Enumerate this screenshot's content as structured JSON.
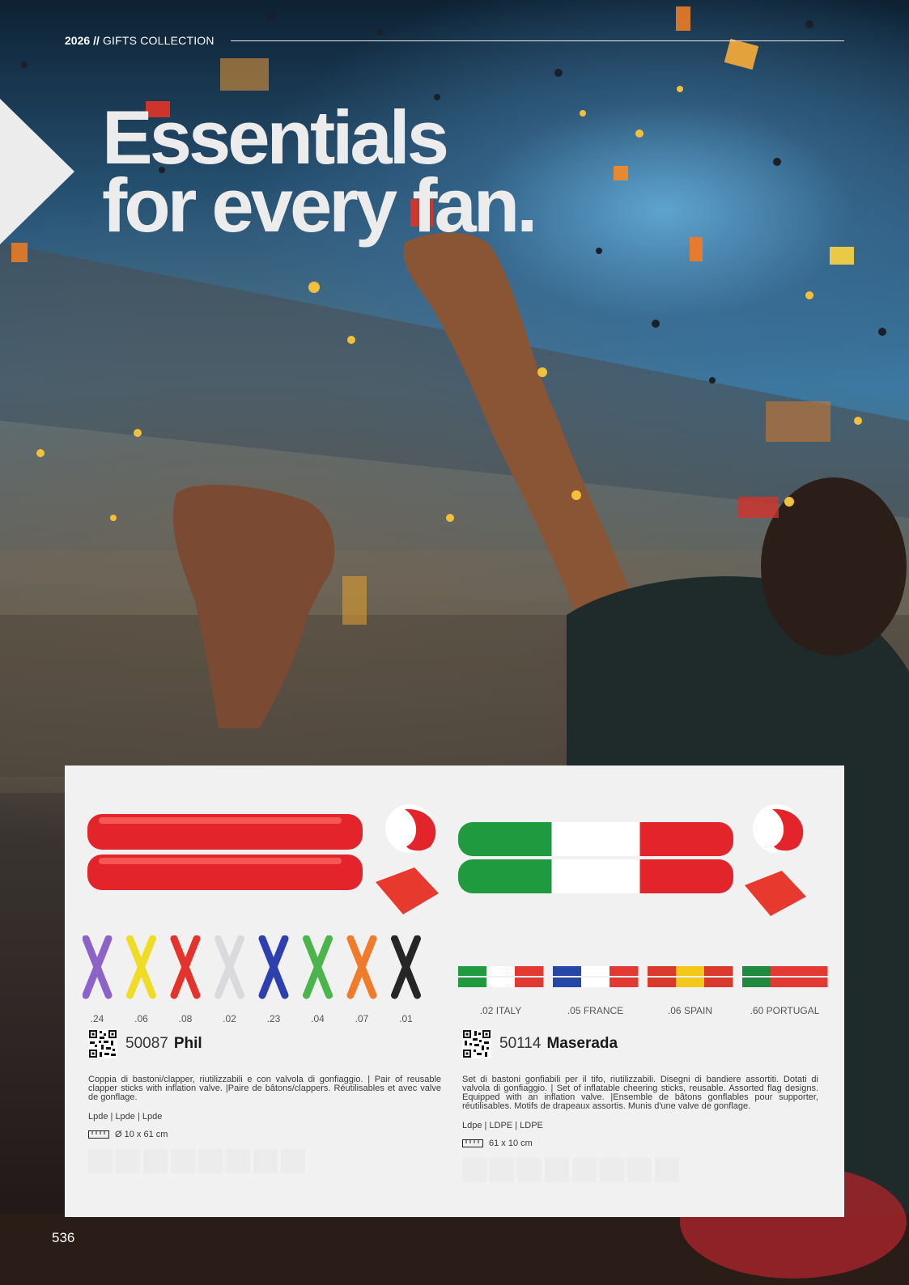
{
  "header": {
    "year": "2026",
    "separator": "//",
    "collection": "GIFTS COLLECTION"
  },
  "title": {
    "line1": "Essentials",
    "line2": "for every fan."
  },
  "products": [
    {
      "code": "50087",
      "name": "Phil",
      "description": "Coppia di bastoni/clapper, riutilizzabili e con valvola di gonfiaggio. | Pair of reusable clapper sticks with inflation valve. |Paire de bâtons/clappers. Réutilisables et avec valve de gonflage.",
      "material": "Lpde | Lpde | Lpde",
      "dimensions": "Ø 10 x 61 cm",
      "colors": [
        {
          "code": ".24",
          "hex": "#8d63c8"
        },
        {
          "code": ".06",
          "hex": "#f0dc24"
        },
        {
          "code": ".08",
          "hex": "#e3332c"
        },
        {
          "code": ".02",
          "hex": "#e0e0e2"
        },
        {
          "code": ".23",
          "hex": "#2e3fb0"
        },
        {
          "code": ".04",
          "hex": "#4bb54c"
        },
        {
          "code": ".07",
          "hex": "#f07b2a"
        },
        {
          "code": ".01",
          "hex": "#262626"
        }
      ]
    },
    {
      "code": "50114",
      "name": "Maserada",
      "description": "Set di bastoni gonfiabili per il tifo, riutilizzabili. Disegni di bandiere assortiti. Dotati di valvola di gonfiaggio. | Set of inflatable cheering sticks, reusable. Assorted flag designs. Equipped with an inflation valve. |Ensemble de bâtons gonflables pour supporter, réutilisables. Motifs de drapeaux assortis. Munis d'une valve de gonflage.",
      "material": "Ldpe | LDPE | LDPE",
      "dimensions": "61 x 10 cm",
      "flags": [
        {
          "label": ".02 ITALY",
          "colors": [
            "#1f9a3f",
            "#ffffff",
            "#e23a32"
          ]
        },
        {
          "label": ".05 FRANCE",
          "colors": [
            "#2547a8",
            "#ffffff",
            "#e23a32"
          ]
        },
        {
          "label": ".06 SPAIN",
          "colors": [
            "#d93a2c",
            "#f4c818",
            "#d93a2c"
          ]
        },
        {
          "label": ".60 PORTUGAL",
          "colors": [
            "#1f8a3e",
            "#e23a32",
            "#e23a32"
          ]
        }
      ]
    }
  ],
  "page_number": "536"
}
